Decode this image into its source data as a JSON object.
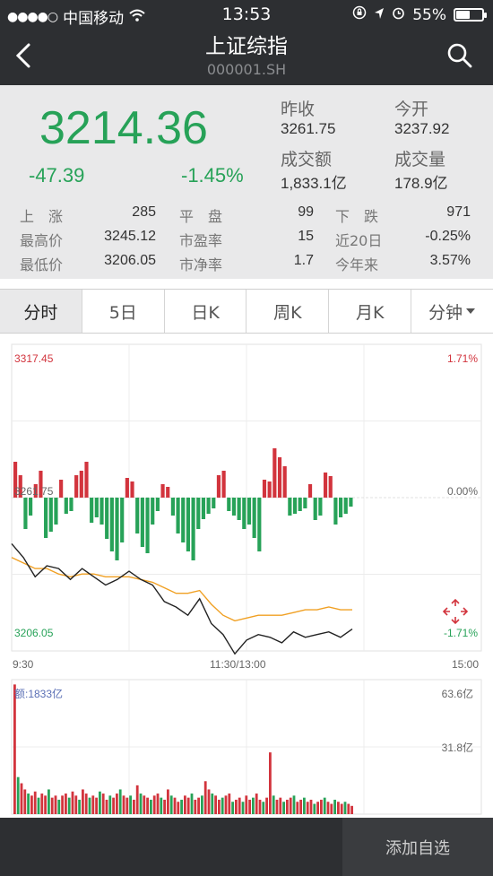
{
  "status_bar": {
    "carrier": "中国移动",
    "time": "13:53",
    "battery": "55%",
    "battery_level": 0.55
  },
  "header": {
    "title": "上证综指",
    "code": "000001.SH"
  },
  "quote": {
    "price": "3214.36",
    "change": "-47.39",
    "change_pct": "-1.45%",
    "prev_close_label": "昨收",
    "prev_close": "3261.75",
    "open_label": "今开",
    "open": "3237.92",
    "amount_label": "成交额",
    "amount": "1,833.1亿",
    "volume_label": "成交量",
    "volume": "178.9亿"
  },
  "stats": [
    [
      {
        "label": "上　涨",
        "value": "285"
      },
      {
        "label": "平　盘",
        "value": "99"
      },
      {
        "label": "下　跌",
        "value": "971"
      }
    ],
    [
      {
        "label": "最高价",
        "value": "3245.12"
      },
      {
        "label": "市盈率",
        "value": "15"
      },
      {
        "label": "近20日",
        "value": "-0.25%"
      }
    ],
    [
      {
        "label": "最低价",
        "value": "3206.05"
      },
      {
        "label": "市净率",
        "value": "1.7"
      },
      {
        "label": "今年来",
        "value": "3.57%"
      }
    ]
  ],
  "tabs": [
    "分时",
    "5日",
    "日K",
    "周K",
    "月K",
    "分钟"
  ],
  "active_tab": 0,
  "chart_labels": {
    "y_max": "3317.45",
    "y_max_pct": "1.71%",
    "y_mid": "3261.75",
    "y_mid_pct": "0.00%",
    "y_min": "3206.05",
    "y_min_pct": "-1.71%",
    "x_start": "9:30",
    "x_mid": "11:30/13:00",
    "x_end": "15:00",
    "volume_label": "额:1833亿",
    "vol_max": "63.6亿",
    "vol_mid": "31.8亿"
  },
  "chart_data": {
    "type": "line",
    "x_range": [
      "9:30",
      "15:00"
    ],
    "ylim": [
      3206.05,
      3317.45
    ],
    "series": [
      {
        "values": [
          3245,
          3240,
          3233,
          3237,
          3236,
          3232,
          3236,
          3233,
          3230,
          3232,
          3235,
          3232,
          3230,
          3224,
          3222,
          3219,
          3225,
          3216,
          3212,
          3205,
          3210,
          3212,
          3211,
          3209,
          3213,
          3211,
          3212,
          3213,
          3211,
          3214
        ]
      },
      {
        "values": [
          3240,
          3238,
          3236,
          3236,
          3234,
          3233,
          3234,
          3234,
          3233,
          3233,
          3233,
          3232,
          3231,
          3229,
          3227,
          3227,
          3228,
          3223,
          3219,
          3217,
          3218,
          3219,
          3219,
          3219,
          3220,
          3221,
          3221,
          3222,
          3221,
          3221
        ]
      }
    ],
    "volume_max": 63.6
  },
  "colors": {
    "up": "#d2343d",
    "down": "#27a258",
    "price_line": "#222222",
    "avg_line": "#f0a023",
    "bg_header": "#2d2f32"
  },
  "footer": {
    "add_label": "添加自选"
  }
}
